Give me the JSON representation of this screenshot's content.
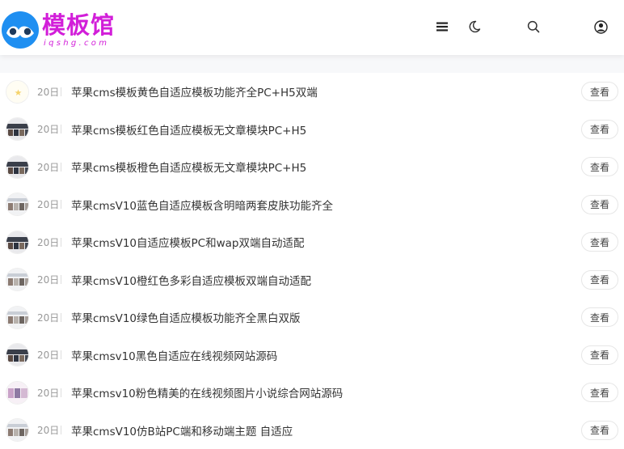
{
  "header": {
    "logo_title": "模板馆",
    "logo_subtitle": "iqshg.com",
    "icons": [
      "menu-icon",
      "moon-icon",
      "search-icon",
      "user-icon"
    ]
  },
  "items": [
    {
      "date": "20日",
      "title": "苹果cms模板黄色自适应模板功能齐全PC+H5双端",
      "button": "查看",
      "thumb": "star"
    },
    {
      "date": "20日",
      "title": "苹果cms模板红色自适应模板无文章模块PC+H5",
      "button": "查看",
      "thumb": "dark"
    },
    {
      "date": "20日",
      "title": "苹果cms模板橙色自适应模板无文章模块PC+H5",
      "button": "查看",
      "thumb": "dark"
    },
    {
      "date": "20日",
      "title": "苹果cmsV10蓝色自适应模板含明暗两套皮肤功能齐全",
      "button": "查看",
      "thumb": "light"
    },
    {
      "date": "20日",
      "title": "苹果cmsV10自适应模板PC和wap双端自动适配",
      "button": "查看",
      "thumb": "dark"
    },
    {
      "date": "20日",
      "title": "苹果cmsV10橙红色多彩自适应模板双端自动适配",
      "button": "查看",
      "thumb": "light"
    },
    {
      "date": "20日",
      "title": "苹果cmsV10绿色自适应模板功能齐全黑白双版",
      "button": "查看",
      "thumb": "light"
    },
    {
      "date": "20日",
      "title": "苹果cmsv10黑色自适应在线视频网站源码",
      "button": "查看",
      "thumb": "dark"
    },
    {
      "date": "20日",
      "title": "苹果cmsv10粉色精美的在线视频图片小说综合网站源码",
      "button": "查看",
      "thumb": "pink"
    },
    {
      "date": "20日",
      "title": "苹果cmsV10仿B站PC端和移动端主题 自适应",
      "button": "查看",
      "thumb": "light"
    }
  ],
  "colors": {
    "brand": "#d21ed9",
    "logo_blue": "#1f8ff1",
    "band": "#f7f8fa"
  }
}
